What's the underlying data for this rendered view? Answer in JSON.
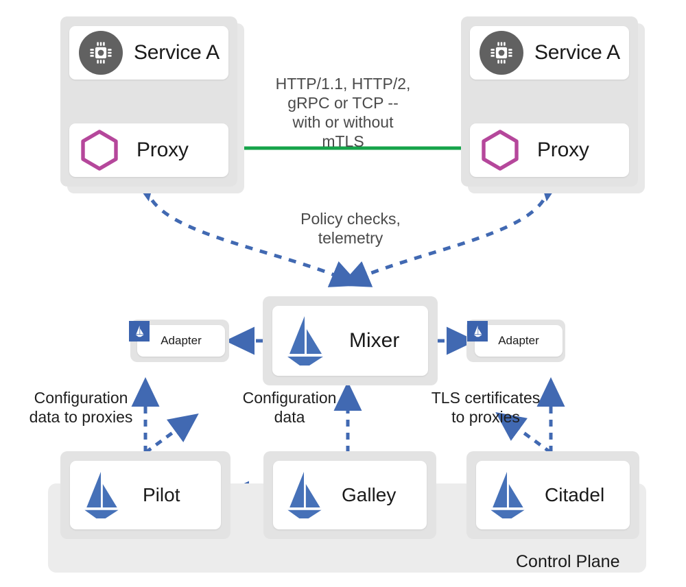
{
  "diagram": {
    "title": "Istio service mesh architecture",
    "colors": {
      "green_arrow": "#16a34a",
      "blue_arrow": "#4169b2",
      "hex_purple": "#b5479b",
      "chip_gray": "#616161",
      "shell_gray": "#e3e3e3",
      "band_gray": "#ececec",
      "logo_blue": "#4671b8"
    }
  },
  "data_plane": {
    "left_panel": {
      "service": {
        "label": "Service A",
        "icon": "cpu-chip-icon"
      },
      "proxy": {
        "label": "Proxy",
        "icon": "hexagon-icon"
      }
    },
    "right_panel": {
      "service": {
        "label": "Service A",
        "icon": "cpu-chip-icon"
      },
      "proxy": {
        "label": "Proxy",
        "icon": "hexagon-icon"
      }
    },
    "traffic_label": "HTTP/1.1, HTTP/2,\ngRPC or TCP --\nwith or without\nmTLS",
    "telemetry_label": "Policy checks,\ntelemetry"
  },
  "mixer": {
    "label": "Mixer",
    "icon": "istio-sail-icon",
    "adapter_left": {
      "label": "Adapter",
      "icon": "istio-sail-badge-icon"
    },
    "adapter_right": {
      "label": "Adapter",
      "icon": "istio-sail-badge-icon"
    }
  },
  "control_plane": {
    "band_label": "Control Plane",
    "components": [
      {
        "label": "Pilot",
        "icon": "istio-sail-icon"
      },
      {
        "label": "Galley",
        "icon": "istio-sail-icon"
      },
      {
        "label": "Citadel",
        "icon": "istio-sail-icon"
      }
    ],
    "annotations": {
      "config_to_proxies": "Configuration\ndata to proxies",
      "config_data": "Configuration\ndata",
      "tls_certs": "TLS certificates\nto proxies"
    }
  }
}
